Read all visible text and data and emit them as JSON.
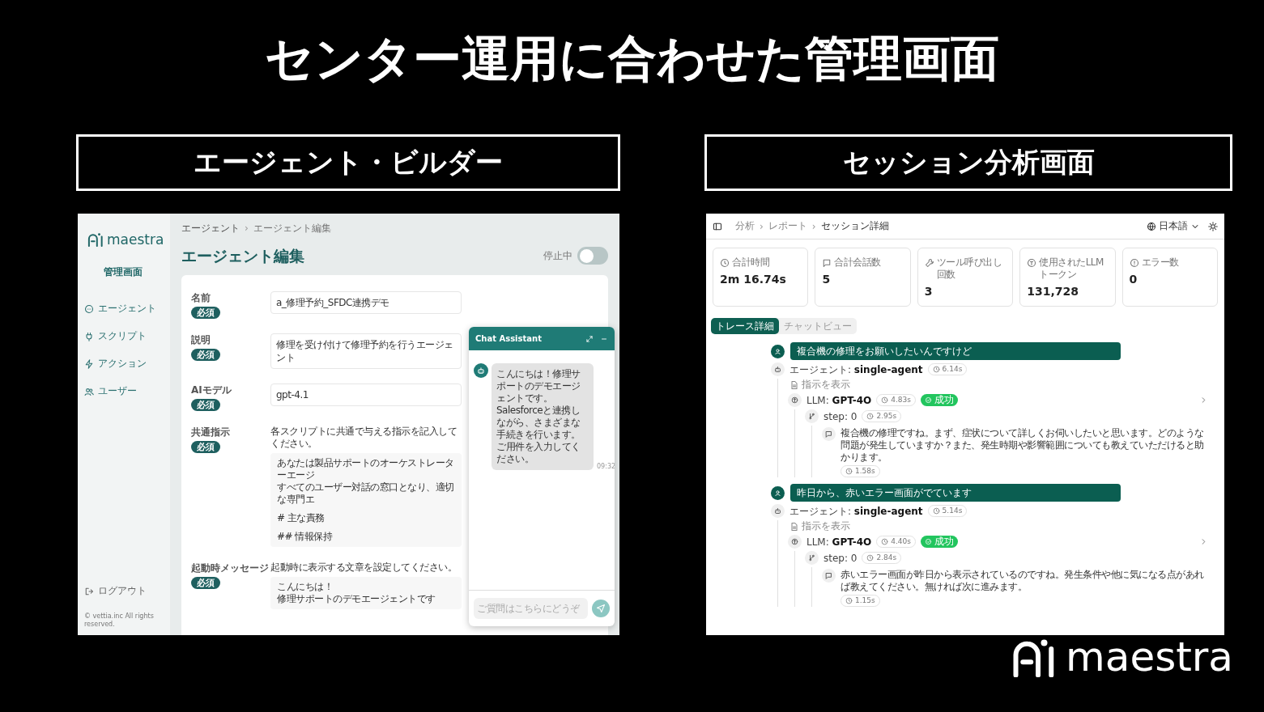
{
  "slide": {
    "title": "センター運用に合わせた管理画面"
  },
  "left": {
    "heading": "エージェント・ビルダー",
    "screen": {
      "sidebar": {
        "logo": "maestra",
        "subtitle": "管理画面",
        "items": [
          {
            "kind": "agent",
            "label": "エージェント"
          },
          {
            "kind": "script",
            "label": "スクリプト"
          },
          {
            "kind": "action",
            "label": "アクション"
          },
          {
            "kind": "user",
            "label": "ユーザー"
          }
        ],
        "logout": "ログアウト",
        "copyright": "© vettia.inc All rights reserved."
      },
      "breadcrumb": {
        "items": [
          "エージェント",
          "エージェント編集"
        ],
        "separator": "›"
      },
      "page_title": "エージェント編集",
      "toggle": {
        "label": "停止中",
        "on": false
      },
      "fields": [
        {
          "kind": "input",
          "label": "名前",
          "badge": "必須",
          "value": "a_修理予約_SFDC連携デモ"
        },
        {
          "kind": "input",
          "label": "説明",
          "badge": "必須",
          "value": "修理を受け付けて修理予約を行うエージェント"
        },
        {
          "kind": "input",
          "label": "AIモデル",
          "badge": "必須",
          "value": "gpt-4.1"
        },
        {
          "kind": "textarea",
          "label": "共通指示",
          "badge": "必須",
          "hint": "各スクリプトに共通で与える指示を記入してください。",
          "paragraphs": [
            [
              "あなたは製品サポートのオーケストレーターエージ",
              "すべてのユーザー対話の窓口となり、適切な専門エ"
            ],
            [
              "# 主な責務"
            ],
            [
              "## 情報保持"
            ]
          ]
        },
        {
          "kind": "textarea",
          "label": "起動時メッセージ",
          "badge": "必須",
          "hint": "起動時に表示する文章を設定してください。",
          "paragraphs": [
            [
              "こんにちは！",
              "修理サポートのデモエージェントです"
            ]
          ]
        }
      ],
      "chat": {
        "title": "Chat Assistant",
        "messages": [
          {
            "text": "こんにちは！修理サポートのデモエージェントです。Salesforceと連携しながら、さまざまな手続きを行います。ご用件を入力してください。",
            "time": "09:32"
          }
        ],
        "input": {
          "placeholder": "ご質問はこちらにどうぞ"
        }
      }
    }
  },
  "right": {
    "heading": "セッション分析画面",
    "screen": {
      "breadcrumb": {
        "items": [
          "分析",
          "レポート",
          "セッション詳細"
        ],
        "separator": "›"
      },
      "language": "日本語",
      "stats": [
        {
          "kind": "time",
          "label": "合計時間",
          "value": "2m 16.74s"
        },
        {
          "kind": "chat",
          "label": "合計会話数",
          "value": "5"
        },
        {
          "kind": "tool",
          "label": "ツール呼び出し回数",
          "value": "3"
        },
        {
          "kind": "token",
          "label": "使用されたLLMトークン",
          "value": "131,728"
        },
        {
          "kind": "error",
          "label": "エラー数",
          "value": "0"
        }
      ],
      "tabs": [
        {
          "label": "トレース詳細",
          "selected": true
        },
        {
          "label": "チャットビュー",
          "selected": false
        }
      ],
      "turns": [
        {
          "user": "複合機の修理をお願いしたいんですけど",
          "agent": {
            "title": "エージェント: **single-agent**",
            "time": "6.14s",
            "link": "指示を表示",
            "llm": {
              "title": "LLM: **GPT-4O**",
              "time": "4.83s",
              "status": {
                "kind": "success",
                "label": "成功"
              },
              "step": {
                "title": "step: 0",
                "time": "2.95s",
                "reply": {
                  "text": "複合機の修理ですね。まず、症状について詳しくお伺いしたいと思います。どのような問題が発生していますか？また、発生時期や影響範囲についても教えていただけると助かります。",
                  "time": "1.58s"
                }
              }
            }
          }
        },
        {
          "user": "昨日から、赤いエラー画面がでています",
          "agent": {
            "title": "エージェント: **single-agent**",
            "time": "5.14s",
            "link": "指示を表示",
            "llm": {
              "title": "LLM: **GPT-4O**",
              "time": "4.40s",
              "status": {
                "kind": "success",
                "label": "成功"
              },
              "step": {
                "title": "step: 0",
                "time": "2.84s",
                "reply": {
                  "text": "赤いエラー画面が昨日から表示されているのですね。発生条件や他に気になる点があれば教えてください。無ければ次に進みます。",
                  "time": "1.15s"
                }
              }
            }
          }
        }
      ]
    }
  },
  "footer": {
    "logo": "maestra"
  }
}
